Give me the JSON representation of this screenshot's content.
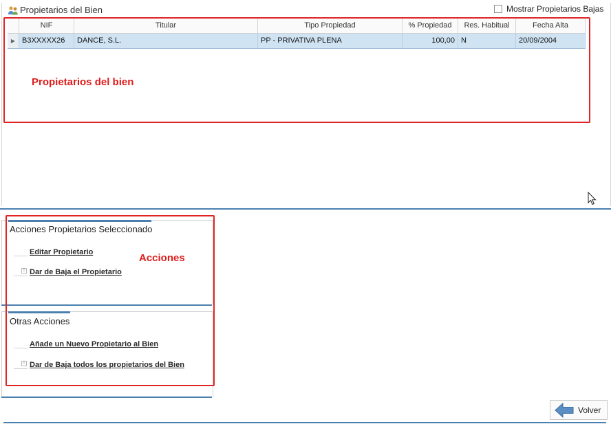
{
  "panel": {
    "title": "Propietarios del Bien",
    "show_bajas_label": "Mostrar Propietarios Bajas"
  },
  "grid": {
    "columns": [
      "NIF",
      "Titular",
      "Tipo Propiedad",
      "% Propiedad",
      "Res. Habitual",
      "Fecha Alta"
    ],
    "rows": [
      {
        "nif": "B3XXXXX26",
        "titular": "DANCE, S.L.",
        "tipo": "PP - PRIVATIVA PLENA",
        "porcentaje": "100,00",
        "res_habitual": "N",
        "fecha_alta": "20/09/2004"
      }
    ]
  },
  "annotations": {
    "grid_label": "Propietarios del bien",
    "actions_label": "Acciones"
  },
  "actions": {
    "group1": {
      "title": "Acciones Propietarios Seleccionado",
      "items": [
        "Editar Propietario",
        "Dar de Baja el Propietario"
      ]
    },
    "group2": {
      "title": "Otras Acciones",
      "items": [
        "Añade un Nuevo Propietario al Bien",
        "Dar de Baja todos los propietarios del Bien"
      ]
    }
  },
  "footer": {
    "volver_label": "Volver"
  },
  "colors": {
    "accent_blue": "#4a7fae",
    "selected_row": "#cfe3f3",
    "annotation_red": "#e02424"
  },
  "icons": [
    "owners-icon",
    "checkbox-icon",
    "row-indicator-icon",
    "back-arrow-icon",
    "mouse-cursor-icon"
  ]
}
